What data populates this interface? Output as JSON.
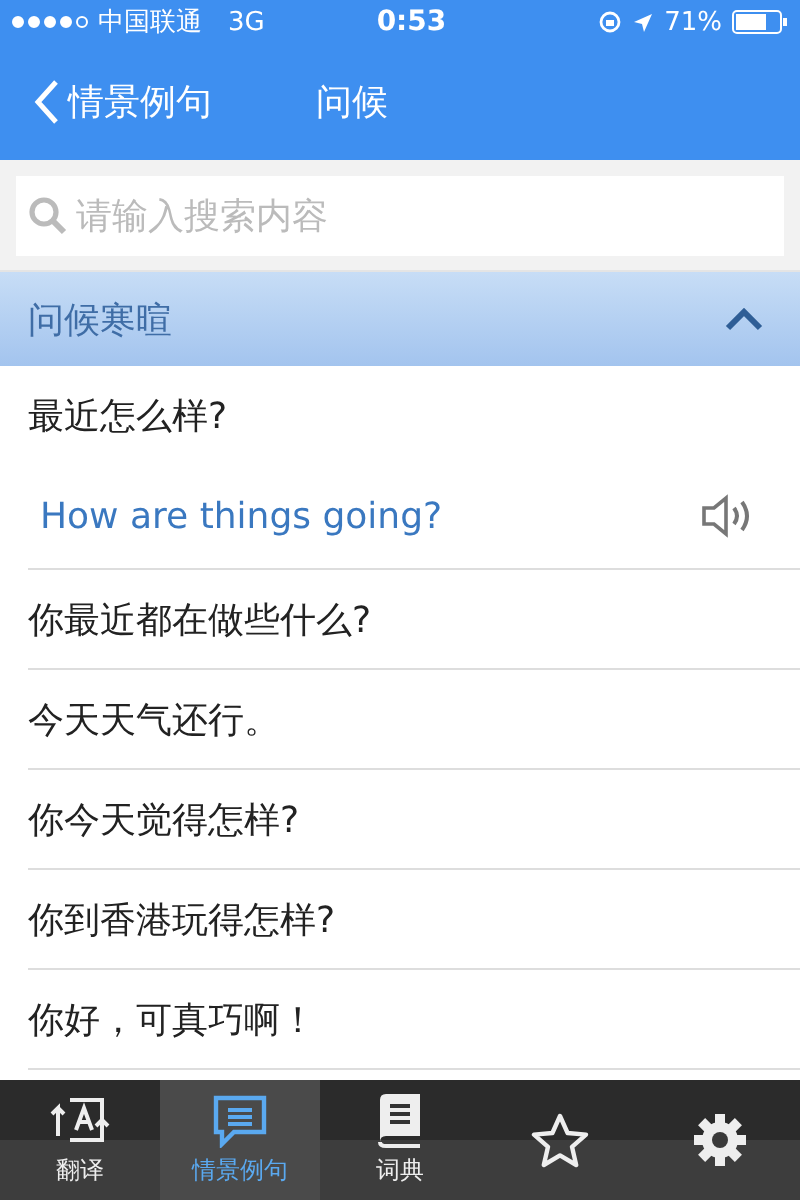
{
  "status_bar": {
    "carrier": "中国联通",
    "network": "3G",
    "time": "0:53",
    "battery_text": "71%"
  },
  "nav": {
    "back_label": "情景例句",
    "title": "问候"
  },
  "search": {
    "placeholder": "请输入搜索内容"
  },
  "section": {
    "title": "问候寒暄",
    "expanded": true
  },
  "phrases": [
    {
      "text": "最近怎么样?",
      "translation": "How are things going?"
    },
    {
      "text": "你最近都在做些什么?"
    },
    {
      "text": "今天天气还行。"
    },
    {
      "text": "你今天觉得怎样?"
    },
    {
      "text": "你到香港玩得怎样?"
    },
    {
      "text": "你好，可真巧啊！"
    }
  ],
  "tabs": [
    {
      "kind": "translate",
      "label": "翻译",
      "selected": false
    },
    {
      "kind": "sentences",
      "label": "情景例句",
      "selected": true
    },
    {
      "kind": "dictionary",
      "label": "词典",
      "selected": false
    },
    {
      "kind": "favorites",
      "selected": false
    },
    {
      "kind": "settings",
      "selected": false
    }
  ]
}
